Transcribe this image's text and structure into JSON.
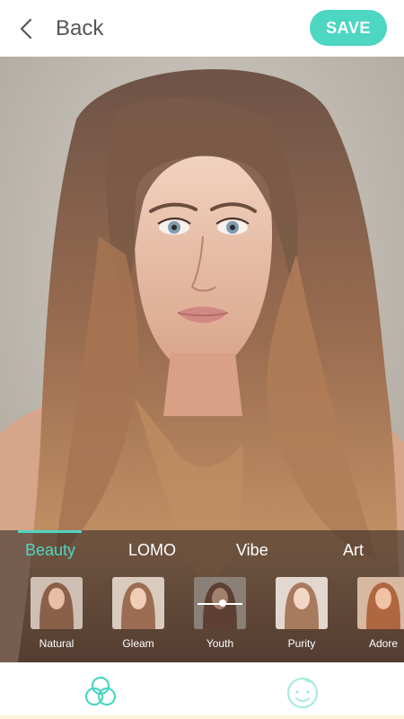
{
  "header": {
    "back_label": "Back",
    "save_label": "SAVE",
    "accent": "#4dd6c2"
  },
  "filters": {
    "tabs": [
      {
        "label": "Beauty",
        "active": true
      },
      {
        "label": "LOMO",
        "active": false
      },
      {
        "label": "Vibe",
        "active": false
      },
      {
        "label": "Art",
        "active": false
      }
    ],
    "presets": [
      {
        "label": "Natural"
      },
      {
        "label": "Gleam"
      },
      {
        "label": "Youth",
        "selected": true
      },
      {
        "label": "Purity"
      },
      {
        "label": "Adore"
      }
    ]
  },
  "bottom_bar": {
    "icons": [
      "filters-icon",
      "face-retouch-icon"
    ]
  }
}
